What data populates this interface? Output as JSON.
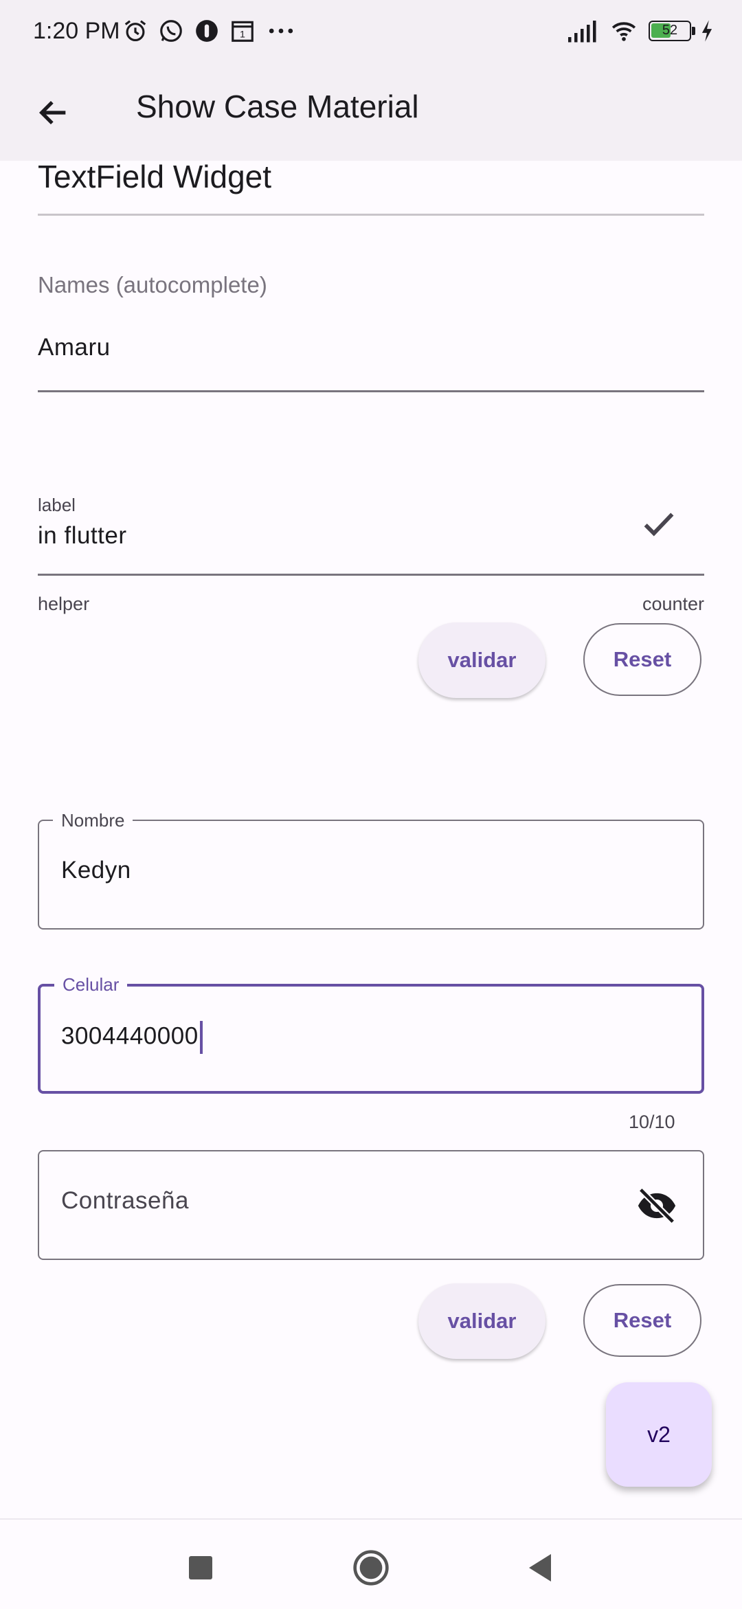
{
  "status_bar": {
    "time": "1:20 PM",
    "battery": "52",
    "left_icons": [
      "alarm-icon",
      "whatsapp-icon",
      "app-icon",
      "calendar-icon",
      "more-icon"
    ],
    "right_icons": [
      "signal-icon",
      "wifi-icon",
      "battery-icon",
      "charging-icon"
    ]
  },
  "app_bar": {
    "title": "Show Case Material",
    "back_icon": "arrow-back-icon"
  },
  "section": {
    "title": "TextField Widget"
  },
  "names_field": {
    "label": "Names (autocomplete)",
    "value": "Amaru"
  },
  "label_field": {
    "label": "label",
    "value": "in flutter",
    "helper": "helper",
    "counter": "counter",
    "suffix_icon": "check-icon"
  },
  "buttons_1": {
    "validate": "validar",
    "reset": "Reset"
  },
  "nombre_field": {
    "label": "Nombre",
    "value": "Kedyn"
  },
  "celular_field": {
    "label": "Celular",
    "value": "3004440000",
    "counter": "10/10"
  },
  "password_field": {
    "placeholder": "Contraseña",
    "suffix_icon": "visibility-off-icon"
  },
  "buttons_2": {
    "validate": "validar",
    "reset": "Reset"
  },
  "fab": {
    "label": "v2"
  },
  "nav_bar": {
    "icons": [
      "recents-icon",
      "home-icon",
      "back-icon"
    ]
  },
  "colors": {
    "primary": "#6750a4",
    "surface": "#fefbff",
    "app_bar": "#f3eff4",
    "fab": "#eaddff",
    "outline": "#79747e"
  }
}
